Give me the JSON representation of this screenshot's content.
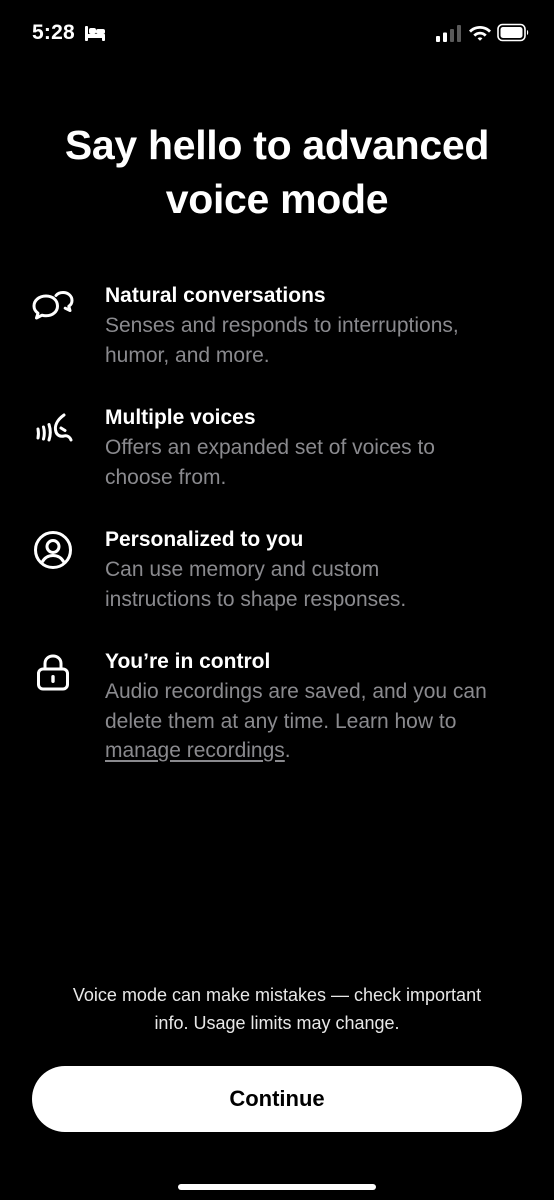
{
  "status_bar": {
    "time": "5:28",
    "icons": [
      "bed-icon",
      "signal-icon",
      "wifi-icon",
      "battery-icon"
    ]
  },
  "title": {
    "line1": "Say hello to advanced",
    "line2": "voice mode"
  },
  "features": [
    {
      "icon": "chat-bubbles-icon",
      "title": "Natural conversations",
      "desc_line1": "Senses and responds to interruptions,",
      "desc_line2": "humor, and more."
    },
    {
      "icon": "speaking-voice-icon",
      "title": "Multiple voices",
      "desc_line1": "Offers an expanded set of voices to",
      "desc_line2": "choose from."
    },
    {
      "icon": "person-circle-icon",
      "title": "Personalized to you",
      "desc_line1": "Can use memory and custom",
      "desc_line2": "instructions to shape responses."
    },
    {
      "icon": "lock-icon",
      "title": "You’re in control",
      "desc_line1": "Audio recordings are saved, and you can",
      "desc_line2": "delete them at any time. Learn how to",
      "link_text": "manage recordings",
      "link_suffix": "."
    }
  ],
  "footer": {
    "disclaimer_line1": "Voice mode can make mistakes — check important",
    "disclaimer_line2": "info. Usage limits may change.",
    "continue_label": "Continue"
  },
  "colors": {
    "background": "#000000",
    "primary_text": "#ffffff",
    "secondary_text": "#8a8a8e",
    "button_bg": "#ffffff",
    "button_text": "#000000"
  }
}
